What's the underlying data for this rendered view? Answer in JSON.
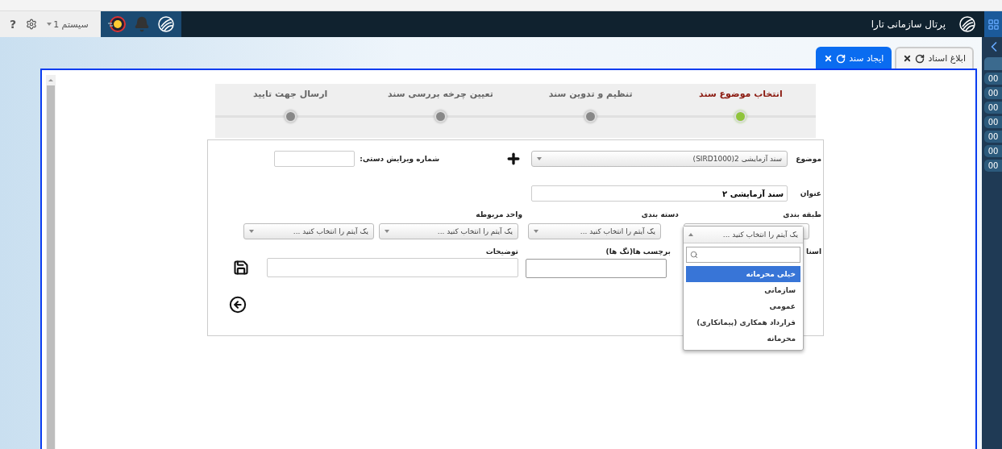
{
  "header": {
    "help": "?",
    "system_menu": "سیستم 1",
    "portal_title": "پرتال سازمانی تارا"
  },
  "tabs": [
    {
      "label": "ابلاغ اسناد",
      "selected": false
    },
    {
      "label": "ایجاد سند",
      "selected": true
    }
  ],
  "rail": {
    "badges": [
      "00",
      "00",
      "00",
      "00",
      "00",
      "00",
      "00"
    ]
  },
  "stepper": [
    {
      "label": "انتخاب موضوع سند",
      "selected": true
    },
    {
      "label": "تنظیم و تدوین سند",
      "selected": false
    },
    {
      "label": "تعیین چرخه بررسی سند",
      "selected": false
    },
    {
      "label": "ارسال جهت تایید",
      "selected": false
    }
  ],
  "form": {
    "subject": {
      "label": "موضوع",
      "value": "سند آزمایشی 2(SIRD1000)"
    },
    "manual_revision": {
      "label": "شماره ویرایش دستی:"
    },
    "title": {
      "label": "عنوان",
      "value": "سند آزمایشی ۲"
    },
    "selects": [
      {
        "label": "طبقه بندی",
        "placeholder": "یک آیتم را انتخاب کنید ...",
        "expanded": true
      },
      {
        "label": "دسته بندی",
        "placeholder": "یک آیتم را انتخاب کنید ...",
        "expanded": false
      },
      {
        "label": "واحد مربوطه",
        "placeholder": "یک آیتم را انتخاب کنید ...",
        "expanded": false
      },
      {
        "placeholder": "یک آیتم را انتخاب کنید ...",
        "expanded": false
      }
    ],
    "documents_label": "اسنا",
    "tags": {
      "label": "برچسب ها(تگ ها)"
    },
    "description": {
      "label": "توضیحات"
    }
  },
  "dropdown": {
    "options": [
      {
        "label": "خیلی محرمانه",
        "selected": true
      },
      {
        "label": "سازمانی",
        "selected": false
      },
      {
        "label": "عمومی",
        "selected": false
      },
      {
        "label": "قرارداد همکاری (پیمانکاری)",
        "selected": false
      },
      {
        "label": "محرمانه",
        "selected": false
      }
    ]
  }
}
